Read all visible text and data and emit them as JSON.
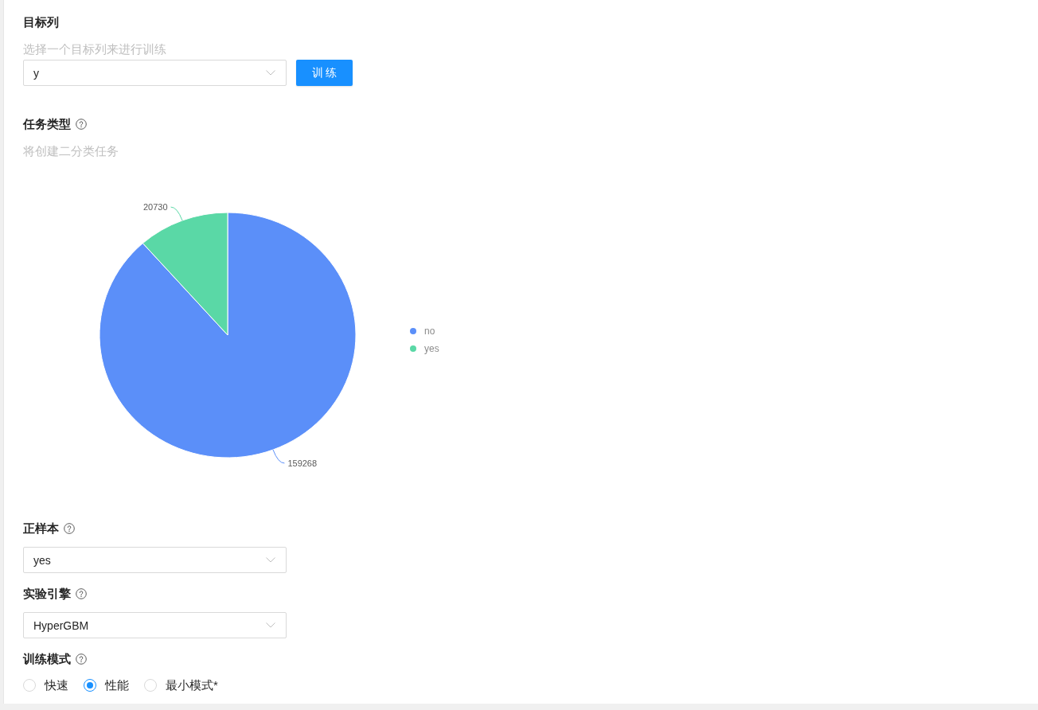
{
  "fields": [
    {
      "kind": "select",
      "label": "目标列",
      "help_icon": false,
      "hint": "选择一个目标列来进行训练",
      "value": "y",
      "button": "训 练"
    },
    {
      "kind": "chart",
      "label": "任务类型",
      "help_icon": true,
      "hint": "将创建二分类任务",
      "chart_data": {
        "type": "pie",
        "categories": [
          "no",
          "yes"
        ],
        "values": [
          159268,
          20730
        ],
        "data_labels": true,
        "value_labels": [
          "159268",
          "20730"
        ],
        "colors": [
          "#5b8ff9",
          "#5ad8a6"
        ],
        "legend": "right"
      }
    },
    {
      "kind": "select",
      "label": "正样本",
      "help_icon": true,
      "value": "yes"
    },
    {
      "kind": "select",
      "label": "实验引擎",
      "help_icon": true,
      "value": "HyperGBM"
    },
    {
      "kind": "radio",
      "label": "训练模式",
      "help_icon": true,
      "options": [
        {
          "label": "快速",
          "selected": false
        },
        {
          "label": "性能",
          "selected": true
        },
        {
          "label": "最小模式*",
          "selected": false
        }
      ]
    }
  ]
}
